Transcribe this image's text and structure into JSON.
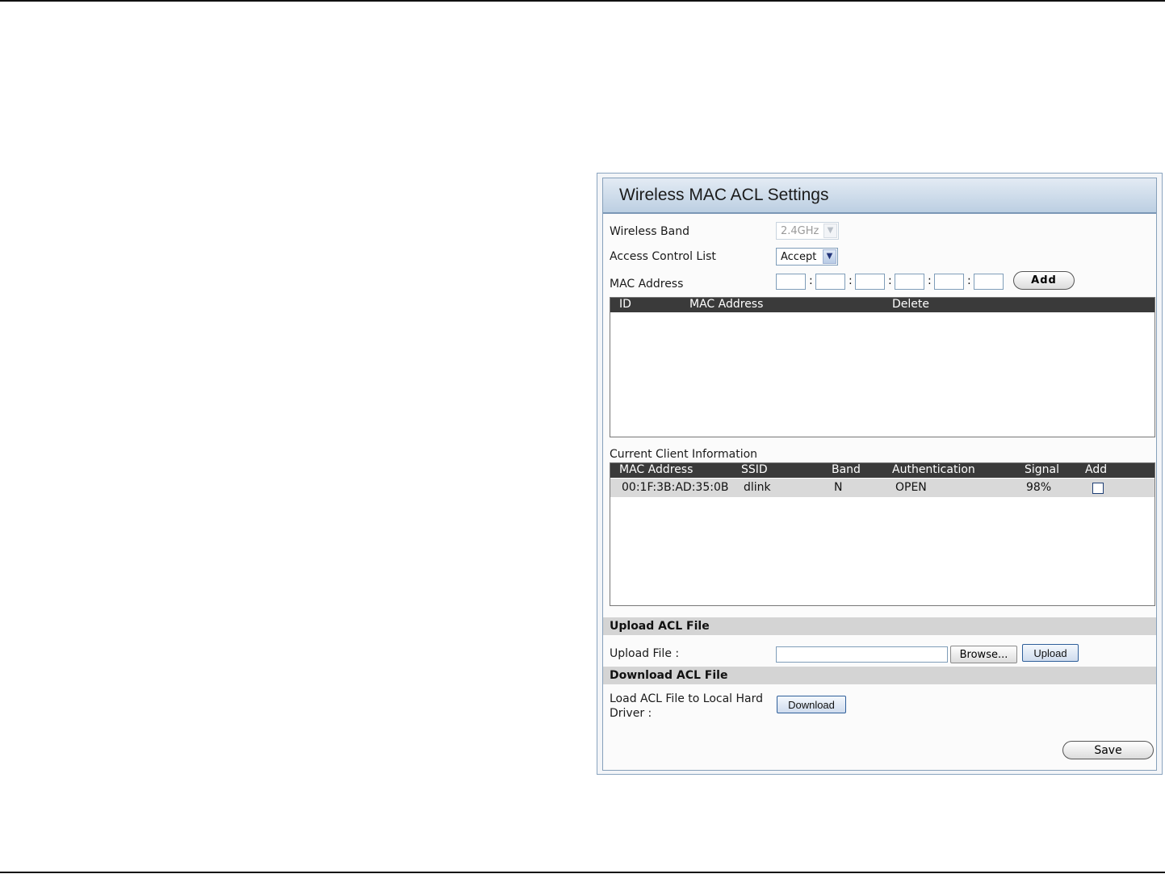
{
  "window": {
    "title": "Wireless MAC ACL Settings"
  },
  "form": {
    "wireless_band_label": "Wireless Band",
    "wireless_band_value": "2.4GHz",
    "acl_label": "Access Control List",
    "acl_value": "Accept",
    "mac_label": "MAC Address",
    "mac_separator": ":",
    "add_button": "Add"
  },
  "acl_table": {
    "columns": [
      "ID",
      "MAC Address",
      "Delete"
    ],
    "rows": []
  },
  "clients": {
    "heading": "Current Client Information",
    "columns": [
      "MAC Address",
      "SSID",
      "Band",
      "Authentication",
      "Signal",
      "Add"
    ],
    "rows": [
      {
        "mac": "00:1F:3B:AD:35:0B",
        "ssid": "dlink",
        "band": "N",
        "auth": "OPEN",
        "signal": "98%",
        "add_checked": false
      }
    ]
  },
  "upload": {
    "section_title": "Upload ACL File",
    "file_label": "Upload File :",
    "file_value": "",
    "browse_button": "Browse...",
    "upload_button": "Upload"
  },
  "download": {
    "section_title": "Download ACL File",
    "label_line1": "Load ACL File to Local Hard",
    "label_line2": "Driver :",
    "download_button": "Download"
  },
  "save_button": "Save"
}
